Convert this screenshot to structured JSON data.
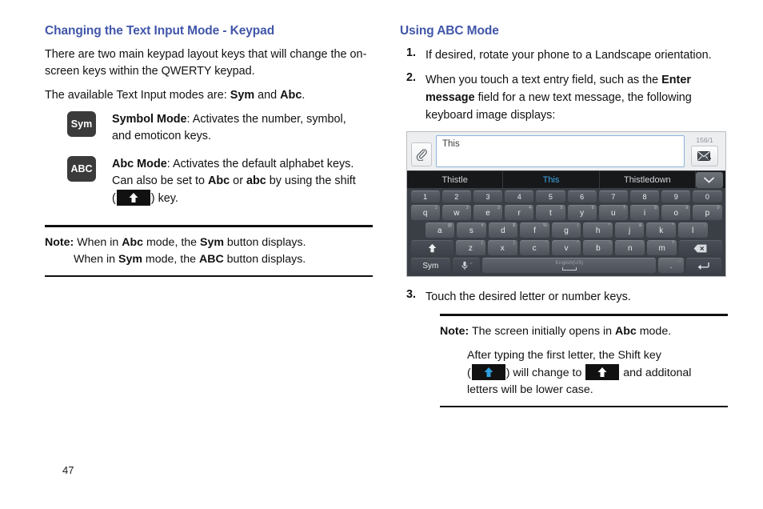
{
  "left": {
    "heading": "Changing the Text Input Mode - Keypad",
    "para1_a": "There are two main keypad layout keys that will change the on-screen keys within the QWERTY keypad.",
    "para2_pre": "The available Text Input modes are: ",
    "para2_b1": "Sym",
    "para2_mid": " and ",
    "para2_b2": "Abc",
    "para2_end": ".",
    "modes": [
      {
        "key_label": "Sym",
        "title": "Symbol Mode",
        "text": ": Activates the number, symbol, and emoticon keys."
      },
      {
        "key_label": "ABC",
        "title": "Abc Mode",
        "text": ": Activates the default alphabet keys.",
        "line2_pre": "Can also be set to ",
        "line2_b1": "Abc",
        "line2_mid": " or ",
        "line2_b2": "abc",
        "line2_end": " by using the shift",
        "line3_open": "(",
        "line3_close": ") key."
      }
    ],
    "note": {
      "label": "Note:",
      "l1_pre": " When in ",
      "l1_b1": "Abc",
      "l1_mid": " mode, the ",
      "l1_b2": "Sym",
      "l1_end": " button displays.",
      "l2_pre": "When in ",
      "l2_b1": "Sym",
      "l2_mid": " mode, the ",
      "l2_b2": "ABC",
      "l2_end": " button displays."
    }
  },
  "right": {
    "heading": "Using ABC Mode",
    "steps": [
      {
        "num": "1.",
        "text": "If desired, rotate your phone to a Landscape orientation."
      },
      {
        "num": "2.",
        "pre": "When you touch a text entry field, such as the ",
        "b1": "Enter message",
        "post": " field for a new text message, the following keyboard image displays:"
      },
      {
        "num": "3.",
        "text": "Touch the desired letter or number keys."
      }
    ],
    "note": {
      "label": "Note:",
      "l1_pre": " The screen initially opens in ",
      "l1_b1": "Abc",
      "l1_end": " mode.",
      "l2_a": "After typing the first letter, the Shift key",
      "l2_open": "(",
      "l2_mid": ") will change to ",
      "l2_tail": " and additonal",
      "l2_b": "letters will be lower case."
    }
  },
  "keyboard": {
    "attach_icon": "paperclip-icon",
    "message_text": "This",
    "char_count": "156/1",
    "send_icon": "send-message-icon",
    "suggestions": [
      {
        "label": "Thistle",
        "active": false
      },
      {
        "label": "This",
        "active": true
      },
      {
        "label": "Thistledown",
        "active": false
      }
    ],
    "more_icon": "chevron-down-icon",
    "rows": {
      "numbers": [
        "1",
        "2",
        "3",
        "4",
        "5",
        "6",
        "7",
        "8",
        "9",
        "0"
      ],
      "qwerty": [
        {
          "k": "q",
          "alt": "1"
        },
        {
          "k": "w",
          "alt": "2"
        },
        {
          "k": "e",
          "alt": "3"
        },
        {
          "k": "r",
          "alt": "4"
        },
        {
          "k": "t",
          "alt": "5"
        },
        {
          "k": "y",
          "alt": "6"
        },
        {
          "k": "u",
          "alt": "7"
        },
        {
          "k": "i",
          "alt": "8"
        },
        {
          "k": "o",
          "alt": "9"
        },
        {
          "k": "p",
          "alt": "0"
        }
      ],
      "asdf": [
        {
          "k": "a",
          "alt": "@"
        },
        {
          "k": "s",
          "alt": "#"
        },
        {
          "k": "d",
          "alt": "$"
        },
        {
          "k": "f",
          "alt": "%"
        },
        {
          "k": "g",
          "alt": "/"
        },
        {
          "k": "h",
          "alt": "^"
        },
        {
          "k": "j",
          "alt": "&"
        },
        {
          "k": "k",
          "alt": "*"
        },
        {
          "k": "l",
          "alt": "-"
        }
      ],
      "zxcv": [
        {
          "k": "z",
          "alt": "("
        },
        {
          "k": "x",
          "alt": ")"
        },
        {
          "k": "c",
          "alt": "'"
        },
        {
          "k": "v",
          "alt": "\""
        },
        {
          "k": "b",
          "alt": ":"
        },
        {
          "k": "n",
          "alt": ";"
        },
        {
          "k": "m",
          "alt": "?"
        }
      ],
      "shift_icon": "shift-up-arrow-icon",
      "backspace_icon": "backspace-icon",
      "sym_label": "Sym",
      "mic_icon": "microphone-icon",
      "space_lang": "English(US)",
      "period_label": ".",
      "period_alt": "...",
      "enter_icon": "enter-return-icon"
    }
  },
  "footer": {
    "page_number": "47"
  }
}
